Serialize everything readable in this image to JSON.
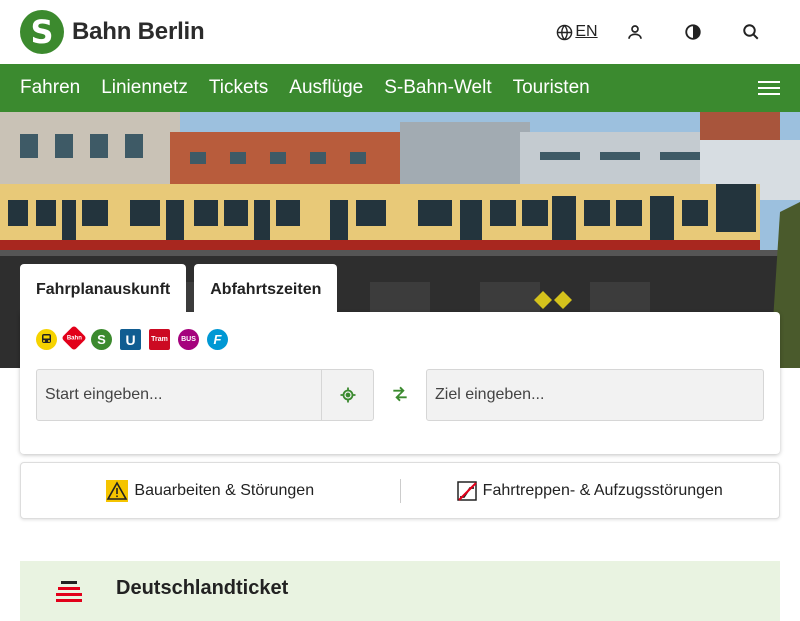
{
  "header": {
    "brand": "Bahn Berlin",
    "logo_letter": "S",
    "language": "EN",
    "icons": [
      "globe-icon",
      "user-icon",
      "contrast-icon",
      "search-icon"
    ]
  },
  "nav": {
    "items": [
      "Fahren",
      "Liniennetz",
      "Tickets",
      "Ausflüge",
      "S-Bahn-Welt",
      "Touristen"
    ],
    "menu_icon": "hamburger-icon"
  },
  "planner": {
    "tabs": [
      "Fahrplanauskunft",
      "Abfahrtszeiten"
    ],
    "modes": [
      {
        "name": "regional-train-icon",
        "label": "",
        "color": "#f6d300"
      },
      {
        "name": "db-bahn-icon",
        "label": "Bahn",
        "color": "#e2001a"
      },
      {
        "name": "s-bahn-icon",
        "label": "S",
        "color": "#3c8a2e"
      },
      {
        "name": "u-bahn-icon",
        "label": "U",
        "color": "#115d91"
      },
      {
        "name": "tram-icon",
        "label": "Tram",
        "color": "#cc0a22"
      },
      {
        "name": "bus-icon",
        "label": "BUS",
        "color": "#a5027d"
      },
      {
        "name": "ferry-icon",
        "label": "F",
        "color": "#0098d4"
      }
    ],
    "start_placeholder": "Start eingeben...",
    "destination_placeholder": "Ziel eingeben..."
  },
  "alerts": {
    "construction": "Bauarbeiten & Störungen",
    "escalators": "Fahrtreppen- & Aufzugsstörungen"
  },
  "promo": {
    "title": "Deutschlandticket"
  },
  "colors": {
    "brand_green": "#3b8a2f",
    "promo_bg": "#e9f3e1"
  }
}
